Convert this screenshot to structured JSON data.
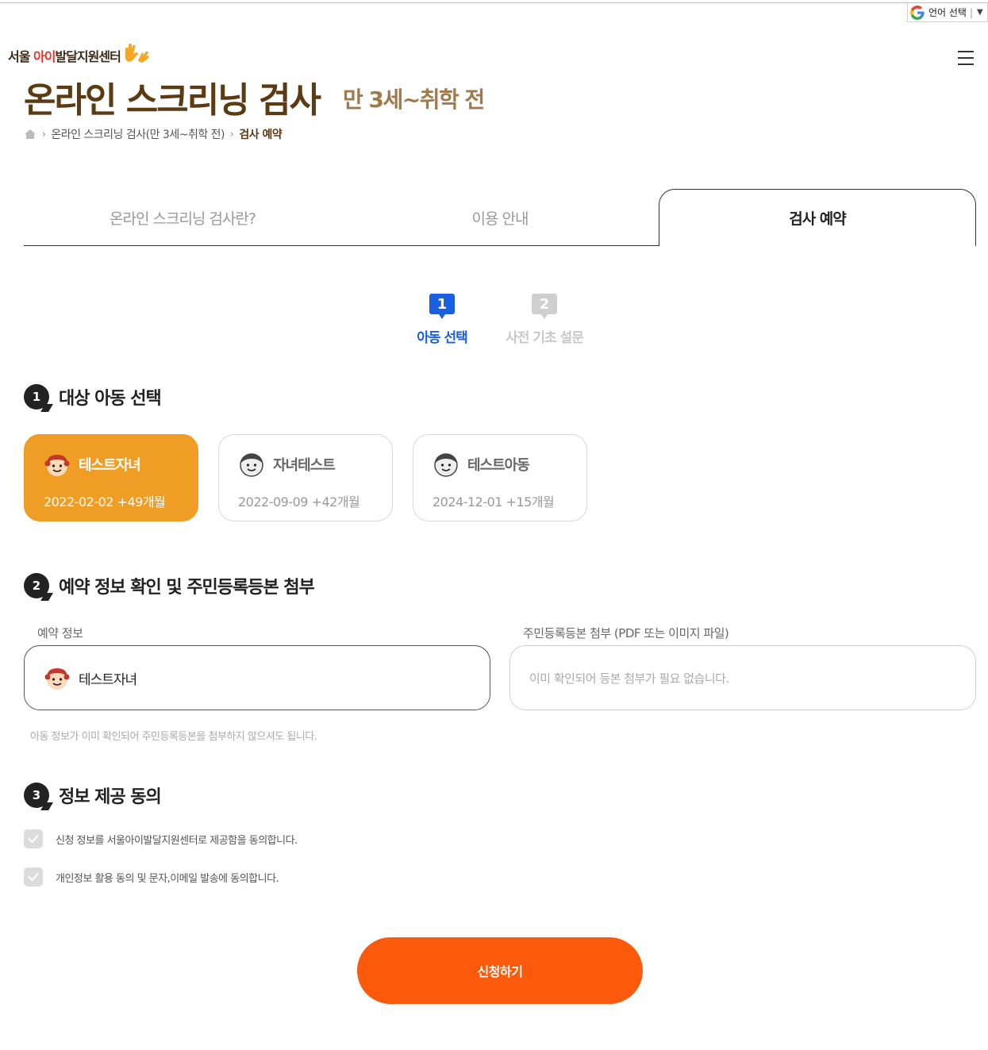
{
  "language_selector": {
    "label": "언어 선택",
    "arrow": "▼"
  },
  "logo": {
    "prefix": "서울 ",
    "accent": "아이",
    "suffix": "발달지원센터"
  },
  "page": {
    "title": "온라인 스크리닝 검사",
    "subtitle": "만 3세~취학 전"
  },
  "breadcrumb": {
    "items": [
      "온라인 스크리닝 검사(만 3세~취학 전)",
      "검사 예약"
    ]
  },
  "tabs": [
    {
      "label": "온라인 스크리닝 검사란?",
      "active": false
    },
    {
      "label": "이용 안내",
      "active": false
    },
    {
      "label": "검사 예약",
      "active": true
    }
  ],
  "steps": [
    {
      "num": "1",
      "label": "아동 선택",
      "active": true
    },
    {
      "num": "2",
      "label": "사전 기초 설문",
      "active": false
    }
  ],
  "sections": [
    {
      "num": "1",
      "title": "대상 아동 선택"
    },
    {
      "num": "2",
      "title": "예약 정보 확인 및 주민등록등본 첨부"
    },
    {
      "num": "3",
      "title": "정보 제공 동의"
    }
  ],
  "children": [
    {
      "name": "테스트자녀",
      "info": "2022-02-02 +49개월",
      "selected": true
    },
    {
      "name": "자녀테스트",
      "info": "2022-09-09 +42개월",
      "selected": false
    },
    {
      "name": "테스트아동",
      "info": "2024-12-01 +15개월",
      "selected": false
    }
  ],
  "reservation": {
    "label": "예약 정보",
    "value": "테스트자녀",
    "attach_label": "주민등록등본 첨부 (PDF 또는 이미지 파일)",
    "attach_placeholder": "이미 확인되어 등본 첨부가 필요 없습니다.",
    "note": "아동 정보가 이미 확인되어 주민등록등본을 첨부하지 않으셔도 됩니다."
  },
  "agreements": [
    {
      "text": "신청 정보를 서울아이발달지원센터로 제공함을 동의합니다.",
      "checked": true
    },
    {
      "text": "개인정보 활용 동의 및 문자,이메일 발송에 동의합니다.",
      "checked": true
    }
  ],
  "submit_label": "신청하기",
  "colors": {
    "brand_brown": "#5c3a12",
    "selected_orange": "#ef9d25",
    "submit_orange": "#fb5a0d",
    "step_blue": "#1a5fe0"
  }
}
